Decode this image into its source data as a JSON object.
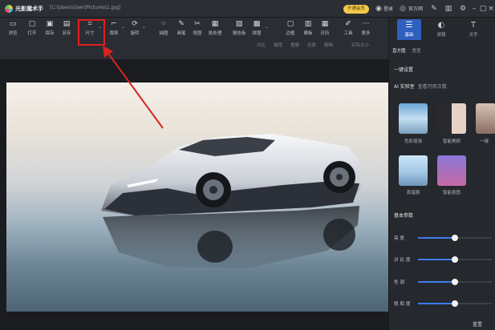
{
  "titlebar": {
    "app_title": "光影魔术手",
    "file_path": "[C:\\Users\\User\\Pictures\\1.jpg]",
    "vip_label": "开通会员",
    "login": "登录",
    "website": "官方网",
    "icons": [
      "user-icon",
      "globe-icon",
      "feather-icon",
      "shirt-icon",
      "gear-icon",
      "minimize-icon",
      "maximize-icon",
      "close-icon"
    ]
  },
  "toolbar": {
    "tools": [
      {
        "label": "浏览",
        "icon": "browse-icon",
        "glyph": "▭"
      },
      {
        "label": "打开",
        "icon": "open-icon",
        "glyph": "▢"
      },
      {
        "label": "保存",
        "icon": "save-icon",
        "glyph": "▣"
      },
      {
        "label": "另存",
        "icon": "save-as-icon",
        "glyph": "▤"
      },
      {
        "label": "尺寸",
        "icon": "resize-icon",
        "glyph": "⌗"
      },
      {
        "label": "裁剪",
        "icon": "crop-icon",
        "glyph": "⌐"
      },
      {
        "label": "旋转",
        "icon": "rotate-icon",
        "glyph": "⟳"
      },
      {
        "label": "抽图",
        "icon": "extract-icon",
        "glyph": "⁘"
      },
      {
        "label": "画笔",
        "icon": "brush-icon",
        "glyph": "✎"
      },
      {
        "label": "抠图",
        "icon": "cutout-icon",
        "glyph": "✂"
      },
      {
        "label": "批处理",
        "icon": "batch-icon",
        "glyph": "▦"
      },
      {
        "label": "报告板",
        "icon": "board-icon",
        "glyph": "▧"
      },
      {
        "label": "拼图",
        "icon": "collage-icon",
        "glyph": "▩"
      },
      {
        "label": "边框",
        "icon": "border-icon",
        "glyph": "▢"
      },
      {
        "label": "模板",
        "icon": "template-icon",
        "glyph": "▥"
      },
      {
        "label": "日历",
        "icon": "calendar-icon",
        "glyph": "▦"
      },
      {
        "label": "工具",
        "icon": "tools-icon",
        "glyph": "✐"
      },
      {
        "label": "更多",
        "icon": "more-icon",
        "glyph": "⋯"
      }
    ],
    "subtools": [
      "对比",
      "撤销",
      "重做",
      "还原",
      "删除"
    ],
    "fit_label": "实际大小"
  },
  "panel": {
    "tabs": [
      {
        "label": "基础",
        "icon": "adjust-icon",
        "glyph": "☰"
      },
      {
        "label": "滤镜",
        "icon": "filter-icon",
        "glyph": "◐"
      },
      {
        "label": "文字",
        "icon": "text-icon",
        "glyph": "T"
      }
    ],
    "subtabs": [
      "直方图",
      "重置"
    ],
    "section_one": "一键设置",
    "ai_title": "AI 实验室",
    "ai_link": "查看可用次数",
    "presets": [
      {
        "label": "色彩增强"
      },
      {
        "label": "智能美颜"
      },
      {
        "label": "一键"
      },
      {
        "label": "蒸馏器"
      },
      {
        "label": "智能抠图"
      }
    ],
    "section_two": "基本参数",
    "sliders": [
      {
        "label": "亮度",
        "value": 0.5
      },
      {
        "label": "对比度",
        "value": 0.5
      },
      {
        "label": "色调",
        "value": 0.5
      },
      {
        "label": "饱和度",
        "value": 0.5
      }
    ],
    "reset": "重置"
  }
}
